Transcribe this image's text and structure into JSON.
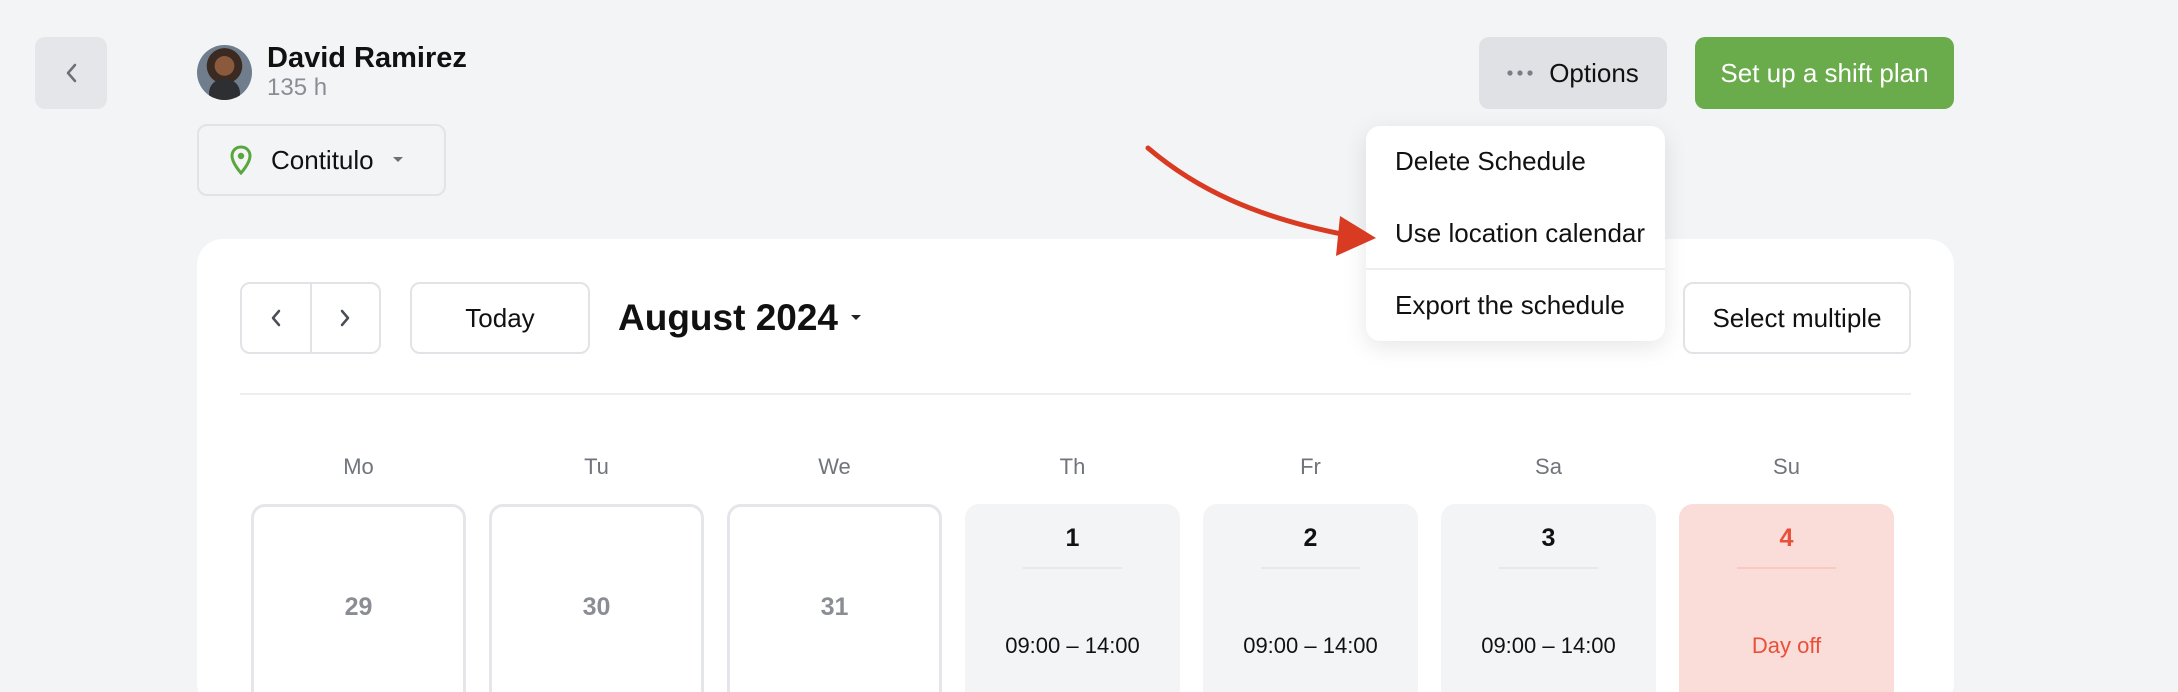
{
  "header": {
    "user_name": "David Ramirez",
    "user_hours": "135 h",
    "location": "Contitulo",
    "options_label": "Options",
    "primary_action": "Set up a shift plan"
  },
  "options_menu": {
    "items": [
      "Delete Schedule",
      "Use location calendar",
      "Export the schedule"
    ]
  },
  "calendar": {
    "today_label": "Today",
    "month_label": "August 2024",
    "select_multiple_label": "Select multiple",
    "weekdays": [
      "Mo",
      "Tu",
      "We",
      "Th",
      "Fr",
      "Sa",
      "Su"
    ],
    "days": [
      {
        "date": "29",
        "state": "outside",
        "info": ""
      },
      {
        "date": "30",
        "state": "outside",
        "info": ""
      },
      {
        "date": "31",
        "state": "outside",
        "info": ""
      },
      {
        "date": "1",
        "state": "shift",
        "info": "09:00 – 14:00"
      },
      {
        "date": "2",
        "state": "shift",
        "info": "09:00 – 14:00"
      },
      {
        "date": "3",
        "state": "shift",
        "info": "09:00 – 14:00"
      },
      {
        "date": "4",
        "state": "day-off",
        "info": "Day off"
      }
    ]
  },
  "colors": {
    "primary": "#6aac4c",
    "day_off_bg": "#fadcd8",
    "day_off_text": "#e8503a",
    "annotation_arrow": "#d83a22"
  }
}
